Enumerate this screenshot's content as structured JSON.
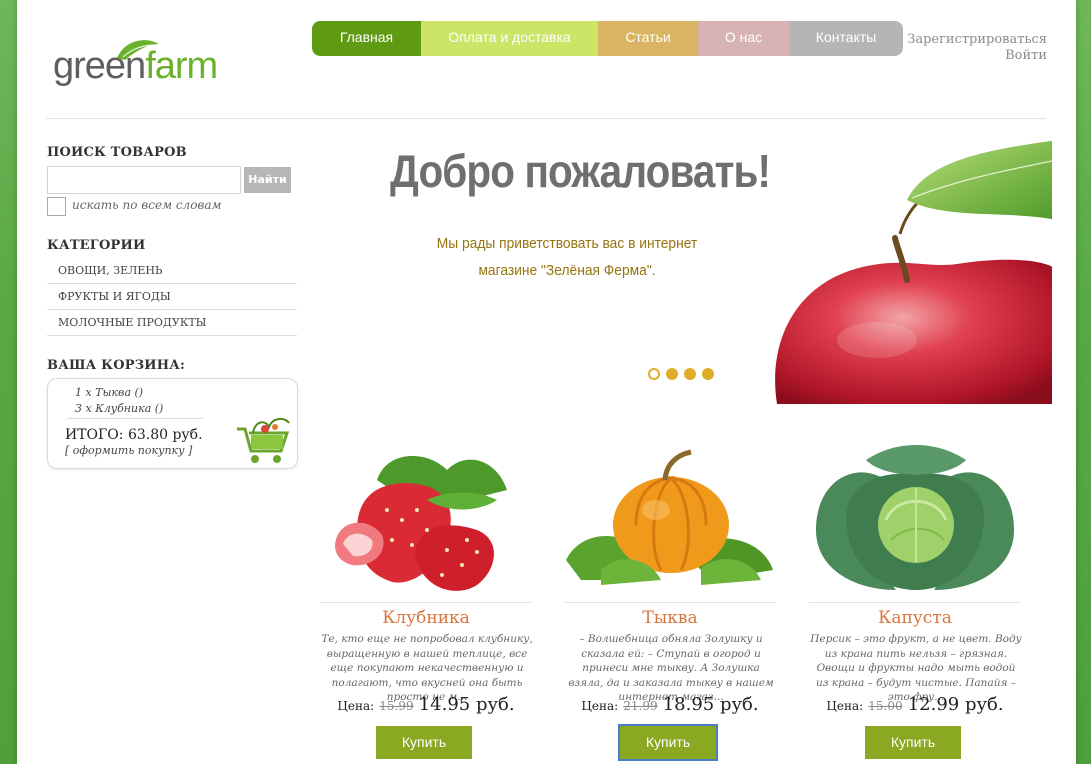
{
  "logo": {
    "part1": "green",
    "part2": "farm"
  },
  "nav": [
    {
      "label": "Главная",
      "color": "#5f9a13"
    },
    {
      "label": "Оплата и доставка",
      "color": "#cde567"
    },
    {
      "label": "Статьи",
      "color": "#d9b462"
    },
    {
      "label": "О нас",
      "color": "#d8b3b3"
    },
    {
      "label": "Контакты",
      "color": "#b5b5b5"
    }
  ],
  "auth": {
    "register": "Зарегистрироваться",
    "login": "Войти"
  },
  "search": {
    "title": "ПОИСК ТОВАРОВ",
    "placeholder": "",
    "button": "Найти",
    "checkbox_label": "искать по всем словам"
  },
  "categories": {
    "title": "КАТЕГОРИИ",
    "items": [
      "ОВОЩИ, ЗЕЛЕНЬ",
      "ФРУКТЫ И ЯГОДЫ",
      "МОЛОЧНЫЕ ПРОДУКТЫ"
    ]
  },
  "cart": {
    "title": "ВАША КОРЗИНА:",
    "lines": [
      "1 x Тыква ()",
      "3 x Клубника ()"
    ],
    "total": "ИТОГО: 63.80 руб.",
    "checkout": "[ оформить покупку ]"
  },
  "banner": {
    "title": "Добро пожаловать!",
    "text": "Мы рады приветствовать вас в интернет магазине \"Зелёная Ферма\".",
    "active_slide": 1,
    "slide_count": 4
  },
  "products": [
    {
      "name": "Клубника",
      "desc": "Те, кто еще не попробовал клубнику, выращенную в нашей теплице, все еще покупают некачественную и полагают, что вкусней она быть просто не м...",
      "price_label": "Цена:",
      "old_price": "15.99",
      "new_price": "14.95 руб.",
      "buy": "Купить"
    },
    {
      "name": "Тыква",
      "desc": "– Волшебница обняла Золушку и сказала ей: – Ступай в огород и принеси мне тыкву. А Золушка взяла, да и заказала тыкву в нашем интернет магаз...",
      "price_label": "Цена:",
      "old_price": "21.99",
      "new_price": "18.95 руб.",
      "buy": "Купить"
    },
    {
      "name": "Капуста",
      "desc": "Персик – это фрукт, а не цвет. Воду из крана пить нельзя – грязная. Овощи и фрукты надо мыть водой из крана – будут чистые. Папайя – это фру...",
      "price_label": "Цена:",
      "old_price": "15.00",
      "new_price": "12.99 руб.",
      "buy": "Купить"
    }
  ]
}
